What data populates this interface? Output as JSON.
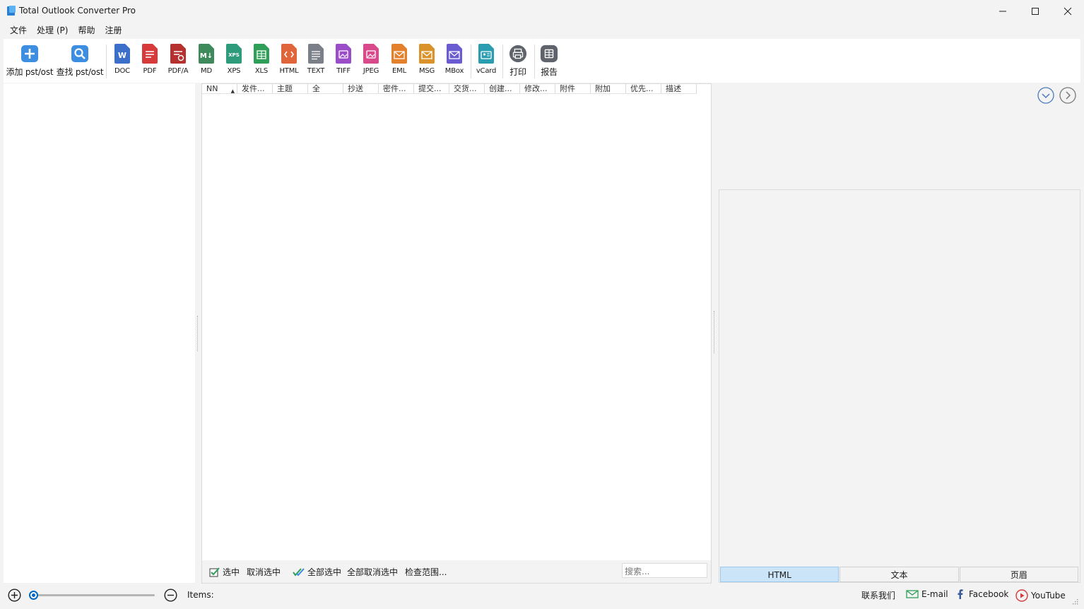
{
  "window": {
    "title": "Total Outlook Converter Pro"
  },
  "menu": [
    "文件",
    "处理 (P)",
    "帮助",
    "注册"
  ],
  "toolbar": {
    "add_pst": "添加 pst/ost",
    "find_pst": "查找 pst/ost",
    "formats": [
      "DOC",
      "PDF",
      "PDF/A",
      "MD",
      "XPS",
      "XLS",
      "HTML",
      "TEXT",
      "TIFF",
      "JPEG",
      "EML",
      "MSG",
      "MBox"
    ],
    "vcard": "vCard",
    "print": "打印",
    "report": "报告"
  },
  "list": {
    "columns": [
      "NN",
      "发件...",
      "主题",
      "全",
      "抄送",
      "密件...",
      "提交...",
      "交货...",
      "创建...",
      "修改...",
      "附件",
      "附加",
      "优先...",
      "描述"
    ],
    "footer": {
      "check": "选中",
      "uncheck": "取消选中",
      "check_all": "全部选中",
      "uncheck_all": "全部取消选中",
      "check_range": "检查范围...",
      "search_placeholder": "搜索..."
    }
  },
  "preview": {
    "tabs": [
      "HTML",
      "文本",
      "页眉"
    ],
    "active_tab": "HTML"
  },
  "status": {
    "items_label": "Items:",
    "contact": "联系我们",
    "email": "E-mail",
    "facebook": "Facebook",
    "youtube": "YouTube"
  },
  "colors": {
    "accent": "#0067c0",
    "active_tab": "#cce4f7",
    "pane_bg": "#ffffff",
    "chrome_bg": "#f3f3f3"
  }
}
